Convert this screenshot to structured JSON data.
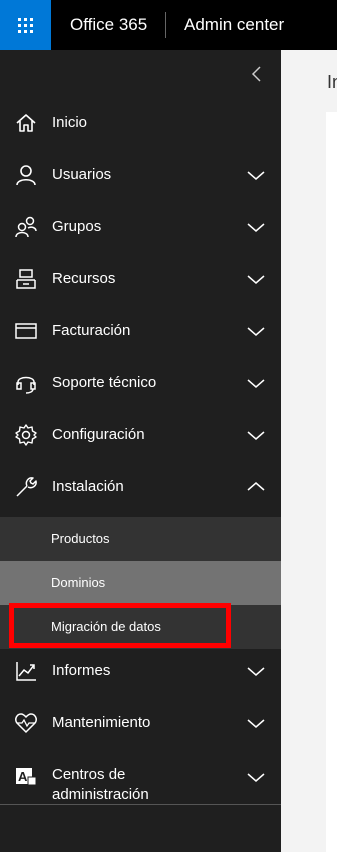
{
  "topbar": {
    "brand": "Office 365",
    "app_name": "Admin center",
    "accent": "#0078d7"
  },
  "sidebar": {
    "collapse_icon": "chevron-left-icon",
    "items": [
      {
        "label": "Inicio",
        "icon": "home-icon",
        "expandable": false
      },
      {
        "label": "Usuarios",
        "icon": "user-icon",
        "expandable": true
      },
      {
        "label": "Grupos",
        "icon": "group-icon",
        "expandable": true
      },
      {
        "label": "Recursos",
        "icon": "resources-icon",
        "expandable": true
      },
      {
        "label": "Facturación",
        "icon": "billing-card-icon",
        "expandable": true
      },
      {
        "label": "Soporte técnico",
        "icon": "headset-icon",
        "expandable": true
      },
      {
        "label": "Configuración",
        "icon": "gear-icon",
        "expandable": true
      },
      {
        "label": "Instalación",
        "icon": "wrench-icon",
        "expandable": true,
        "expanded": true
      },
      {
        "label": "Informes",
        "icon": "chart-line-icon",
        "expandable": true
      },
      {
        "label": "Mantenimiento",
        "icon": "heart-pulse-icon",
        "expandable": true
      },
      {
        "label": "Centros de administración",
        "label_line1": "Centros de",
        "label_line2": "administración",
        "icon": "admin-centers-icon",
        "expandable": true
      }
    ],
    "subitems": [
      {
        "label": "Productos",
        "state": "normal"
      },
      {
        "label": "Dominios",
        "state": "selected"
      },
      {
        "label": "Migración de datos",
        "state": "hover",
        "highlighted": true
      }
    ],
    "colors": {
      "background": "#1f1f1f",
      "submenu_bg": "#333333",
      "selected_bg": "#737373",
      "highlight_border": "#ff0000"
    }
  },
  "content": {
    "title": "In"
  }
}
